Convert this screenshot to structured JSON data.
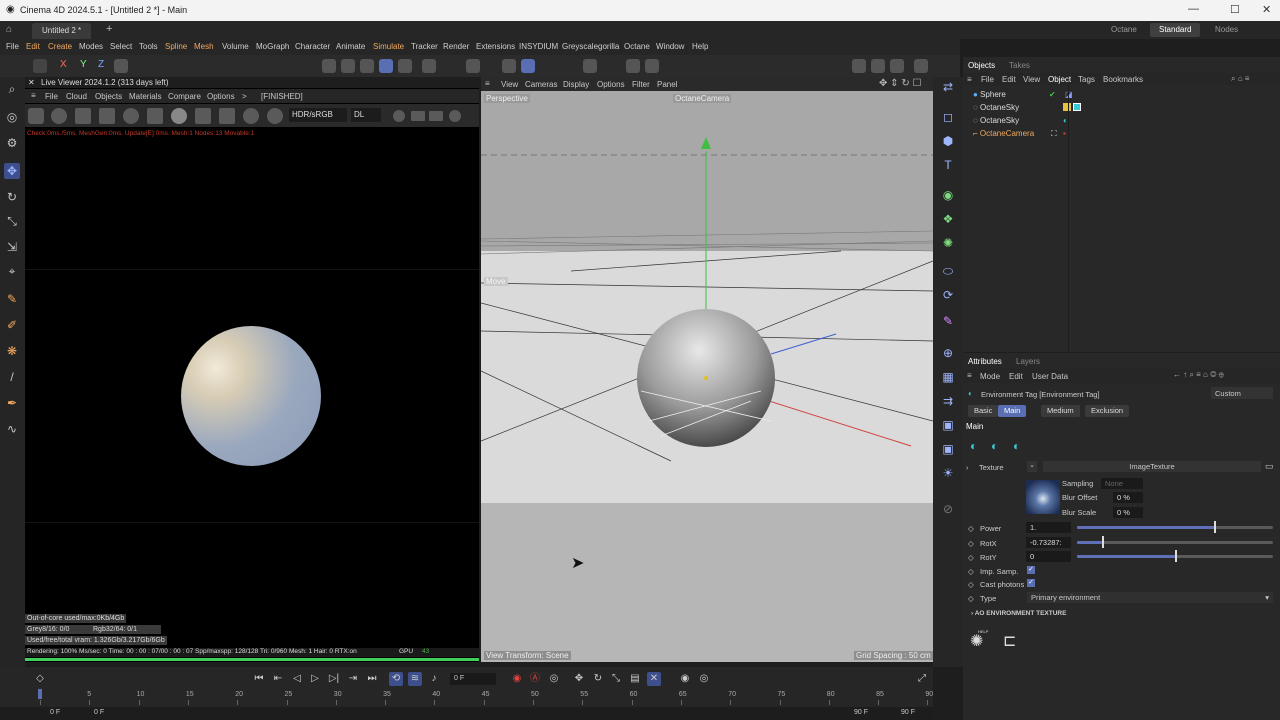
{
  "window": {
    "title": "Cinema 4D 2024.5.1 - [Untitled 2 *] - Main",
    "min": "—",
    "max": "☐",
    "close": "✕"
  },
  "tabs": {
    "doc": "Untitled 2 *",
    "add": "+",
    "modes": [
      "Octane",
      "Standard",
      "Nodes"
    ]
  },
  "menu": [
    "File",
    "Edit",
    "Create",
    "Modes",
    "Select",
    "Tools",
    "Spline",
    "Mesh",
    "Volume",
    "MoGraph",
    "Character",
    "Animate",
    "Simulate",
    "Tracker",
    "Render",
    "Extensions",
    "INSYDIUM",
    "Greyscalegorilla",
    "Octane",
    "Window",
    "Help"
  ],
  "axes": {
    "x": "X",
    "y": "Y",
    "z": "Z"
  },
  "live_viewer": {
    "title": "Live Viewer 2024.1.2 (313 days left)",
    "menu": [
      "File",
      "Cloud",
      "Objects",
      "Materials",
      "Compare",
      "Options",
      ">",
      "[FINISHED]"
    ],
    "hdr": "HDR/sRGB",
    "dl": "DL",
    "status_line": "Check:0ms./5ms. MeshGen:0ms. Update[E]:0ms. Mesh:1 Nodes:13 Movable:1",
    "ooc": "Out-of-core used/max:0Kb/4Gb",
    "grey": "Grey8/16: 0/0",
    "rgb": "Rgb32/64: 0/1",
    "vram": "Used/free/total vram: 1.326Gb/3.217Gb/6Gb",
    "render_line": "Rendering: 100%  Ms/sec: 0   Time: 00 : 00 : 07/00 : 00 : 07  Spp/maxspp: 128/128   Tri: 0/960   Mesh: 1  Hair: 0   RTX:on",
    "gpu": "GPU",
    "gpu_val": "43",
    "progress": 1.0
  },
  "viewport": {
    "menu": [
      "View",
      "Cameras",
      "Display",
      "Options",
      "Filter",
      "Panel"
    ],
    "label": "Perspective",
    "camera": "OctaneCamera",
    "move": "Move",
    "transform": "View Transform: Scene",
    "grid": "Grid Spacing : 50 cm"
  },
  "objects": {
    "tabs": [
      "Objects",
      "Takes"
    ],
    "menu": [
      "File",
      "Edit",
      "View",
      "Object",
      "Tags",
      "Bookmarks"
    ],
    "items": [
      "Sphere",
      "OctaneSky",
      "OctaneSky",
      "OctaneCamera"
    ]
  },
  "attributes": {
    "tabs": [
      "Attributes",
      "Layers"
    ],
    "menu": [
      "Mode",
      "Edit",
      "User Data"
    ],
    "tag": "Environment Tag [Environment Tag]",
    "preset": "Custom",
    "subtabs": [
      "Basic",
      "Main",
      "Medium",
      "Exclusion"
    ],
    "section": "Main",
    "texture_label": "Texture",
    "texture_value": "ImageTexture",
    "sampling_label": "Sampling",
    "sampling_value": "None",
    "blur_offset_label": "Blur Offset",
    "blur_offset_value": "0 %",
    "blur_scale_label": "Blur Scale",
    "blur_scale_value": "0 %",
    "power_label": "Power",
    "power_value": "1.",
    "power_level": 0.7,
    "rotx_label": "RotX",
    "rotx_value": "-0.73287:",
    "rotx_level": 0.13,
    "roty_label": "RotY",
    "roty_value": "0",
    "roty_level": 0.5,
    "imp_label": "Imp. Samp.",
    "cast_label": "Cast photons",
    "type_label": "Type",
    "type_value": "Primary environment",
    "ao_label": "AO ENVIRONMENT TEXTURE",
    "help": "HELP"
  },
  "timeline": {
    "frame": "0 F",
    "start": "0 F",
    "start2": "0 F",
    "end": "90 F",
    "end2": "90 F",
    "ticks": [
      "0",
      "5",
      "10",
      "15",
      "20",
      "25",
      "30",
      "35",
      "40",
      "45",
      "50",
      "55",
      "60",
      "65",
      "70",
      "75",
      "80",
      "85",
      "90"
    ]
  }
}
